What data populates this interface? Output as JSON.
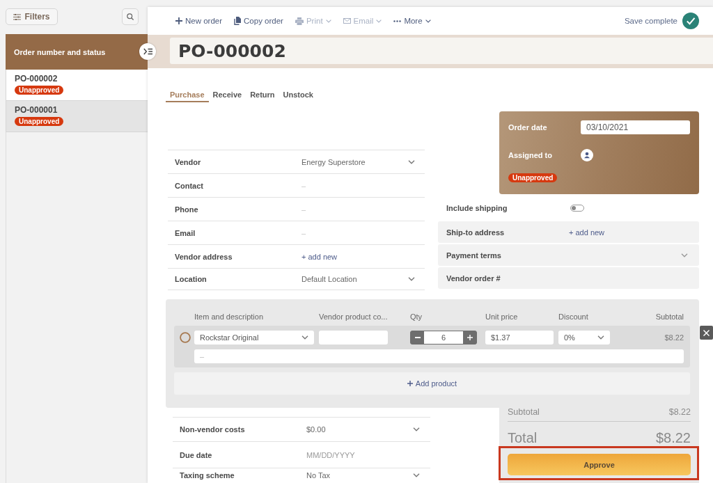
{
  "sidebar": {
    "filters_button": "Filters",
    "list_title": "Order number and status",
    "orders": [
      {
        "number": "PO-000002",
        "status": "Unapproved",
        "selected": true
      },
      {
        "number": "PO-000001",
        "status": "Unapproved",
        "selected": false
      }
    ]
  },
  "toolbar": {
    "actions": [
      {
        "kind": "new",
        "label": "New order",
        "disabled": false,
        "dropdown": false
      },
      {
        "kind": "copy",
        "label": "Copy order",
        "disabled": false,
        "dropdown": false
      },
      {
        "kind": "print",
        "label": "Print",
        "disabled": true,
        "dropdown": true
      },
      {
        "kind": "email",
        "label": "Email",
        "disabled": true,
        "dropdown": true
      },
      {
        "kind": "more",
        "label": "More",
        "disabled": false,
        "dropdown": true
      }
    ],
    "save_status": "Save complete"
  },
  "title": "PO-000002",
  "tabs": [
    {
      "label": "Purchase",
      "selected": true
    },
    {
      "label": "Receive",
      "selected": false
    },
    {
      "label": "Return",
      "selected": false
    },
    {
      "label": "Unstock",
      "selected": false
    }
  ],
  "vendor_fields": [
    {
      "kind": "select",
      "label": "Vendor",
      "value": "Energy Superstore"
    },
    {
      "kind": "text",
      "label": "Contact",
      "placeholder": "–"
    },
    {
      "kind": "text",
      "label": "Phone",
      "placeholder": "–"
    },
    {
      "kind": "text",
      "label": "Email",
      "placeholder": "–"
    },
    {
      "kind": "link",
      "label": "Vendor address",
      "value": "+ add new"
    },
    {
      "kind": "select",
      "label": "Location",
      "value": "Default Location"
    }
  ],
  "order_card": {
    "order_date": {
      "label": "Order date",
      "value": "03/10/2021"
    },
    "assigned_to": {
      "label": "Assigned to"
    },
    "status": "Unapproved"
  },
  "include_shipping": {
    "label": "Include shipping",
    "on": false
  },
  "shipping_fields": [
    {
      "kind": "link",
      "label": "Ship-to address",
      "value": "+ add new"
    },
    {
      "kind": "select",
      "label": "Payment terms"
    },
    {
      "kind": "text",
      "label": "Vendor order #"
    }
  ],
  "items_table": {
    "columns": [
      "Item and description",
      "Vendor product co...",
      "Qty",
      "Unit price",
      "Discount",
      "Subtotal"
    ],
    "rows": [
      {
        "product": "Rockstar Original",
        "qty": "6",
        "unit_price": "$1.37",
        "discount": "0%",
        "subtotal": "$8.22",
        "description_placeholder": "–"
      }
    ],
    "add_button": "Add product"
  },
  "cost_fields": [
    {
      "kind": "select",
      "label": "Non-vendor costs",
      "value": "$0.00"
    },
    {
      "kind": "date",
      "label": "Due date",
      "placeholder": "MM/DD/YYYY"
    },
    {
      "kind": "select",
      "label": "Taxing scheme",
      "value": "No Tax"
    }
  ],
  "totals": {
    "subtotal": {
      "label": "Subtotal",
      "value": "$8.22"
    },
    "total": {
      "label": "Total",
      "value": "$8.22"
    }
  },
  "approve_button": {
    "label": "Approve",
    "highlighted": true
  }
}
